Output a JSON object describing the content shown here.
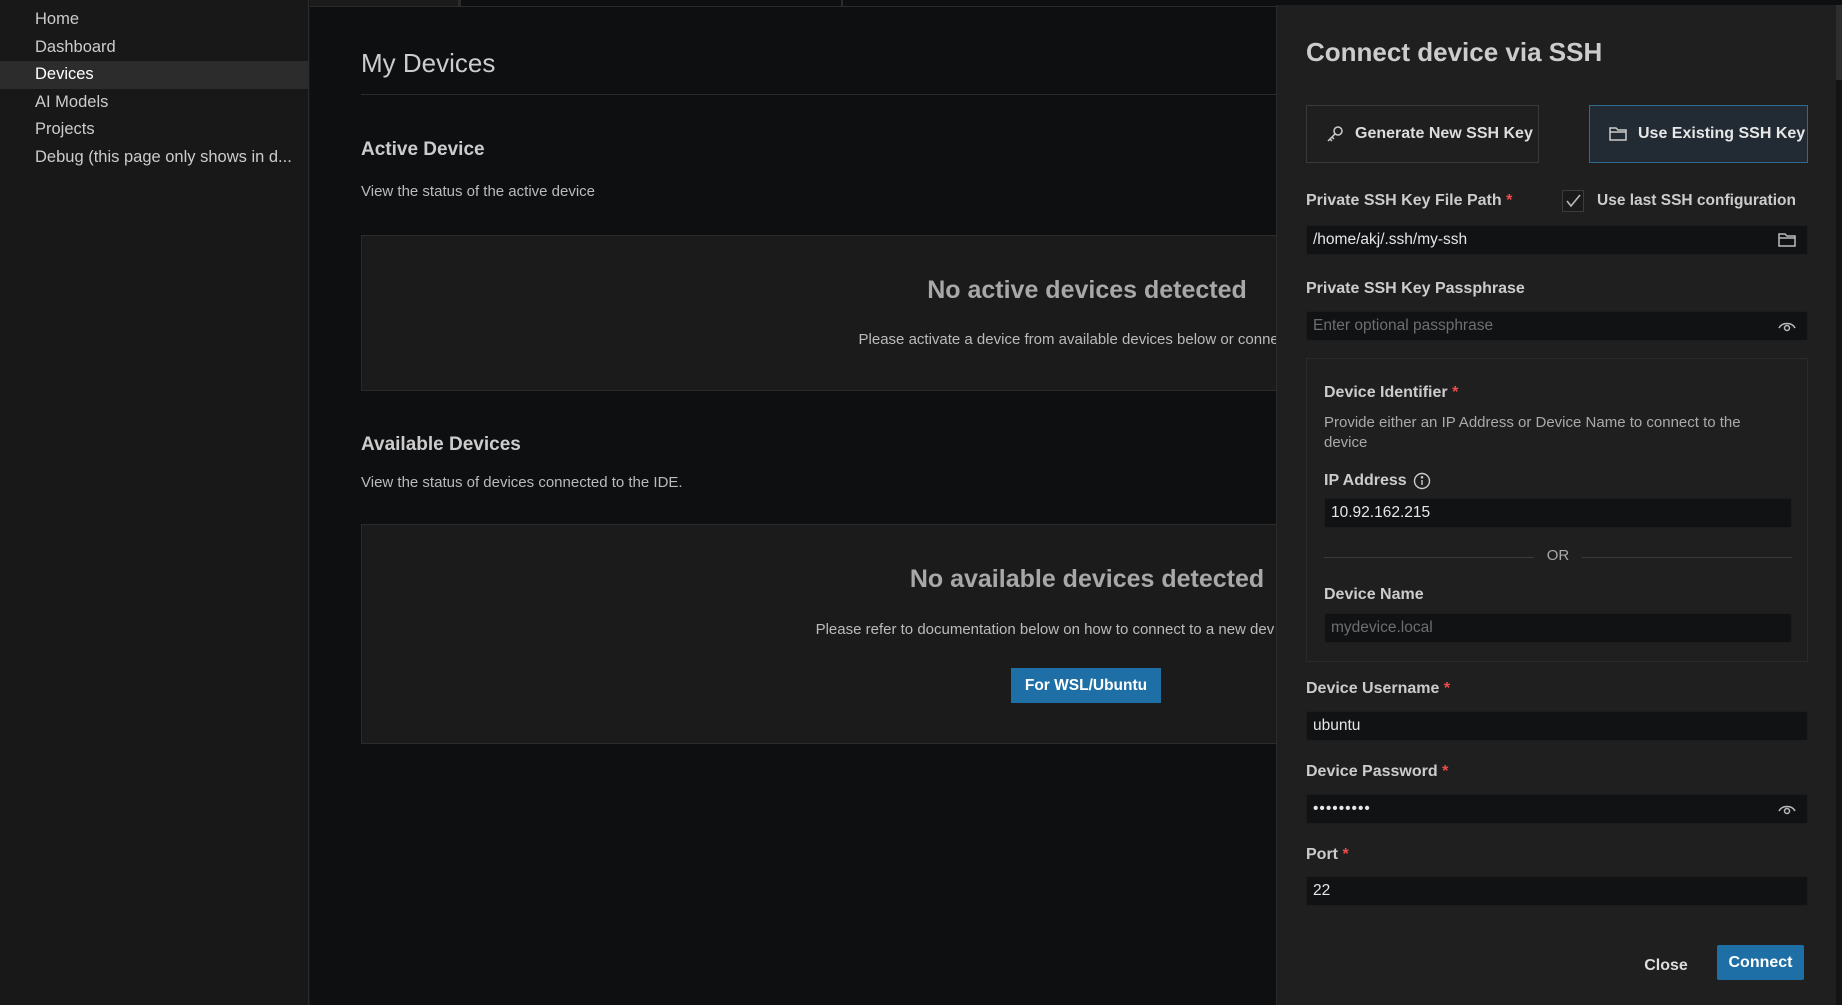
{
  "sidebar": {
    "items": [
      {
        "label": "Home"
      },
      {
        "label": "Dashboard"
      },
      {
        "label": "Devices"
      },
      {
        "label": "AI Models"
      },
      {
        "label": "Projects"
      },
      {
        "label": "Debug (this page only shows in d..."
      }
    ],
    "active_index": 2
  },
  "main": {
    "title": "My Devices",
    "active": {
      "heading": "Active Device",
      "description": "View the status of the active device",
      "empty_title": "No active devices detected",
      "empty_text": "Please activate a device from available devices below or connect a n"
    },
    "available": {
      "heading": "Available Devices",
      "description": "View the status of devices connected to the IDE.",
      "empty_title": "No available devices detected",
      "empty_text": "Please refer to documentation below on how to connect to a new dev kit or activat",
      "button": "For WSL/Ubuntu"
    }
  },
  "panel": {
    "title": "Connect device via SSH",
    "generate_key_label": "Generate New SSH Key",
    "existing_key_label": "Use Existing SSH Key",
    "selected_key_option": "Use Existing SSH Key",
    "key_path": {
      "label": "Private SSH Key File Path",
      "required": "*",
      "value": "/home/akj/.ssh/my-ssh"
    },
    "use_last_config": {
      "label": "Use last SSH configuration",
      "checked": true
    },
    "passphrase": {
      "label": "Private SSH Key Passphrase",
      "placeholder": "Enter optional passphrase"
    },
    "identifier": {
      "label": "Device Identifier",
      "required": "*",
      "hint": "Provide either an IP Address or Device Name to connect to the device",
      "ip_label": "IP Address",
      "ip_value": "10.92.162.215",
      "or_text": "OR",
      "name_label": "Device Name",
      "name_placeholder": "mydevice.local"
    },
    "username": {
      "label": "Device Username",
      "required": "*",
      "value": "ubuntu"
    },
    "password": {
      "label": "Device Password",
      "required": "*",
      "value": "•••••••••"
    },
    "port": {
      "label": "Port",
      "required": "*",
      "value": "22"
    },
    "close_label": "Close",
    "connect_label": "Connect"
  },
  "colors": {
    "accent": "#1d6fa5",
    "required": "#f14c4c",
    "background": "#0e0f11",
    "panel": "#1f1f1f"
  }
}
